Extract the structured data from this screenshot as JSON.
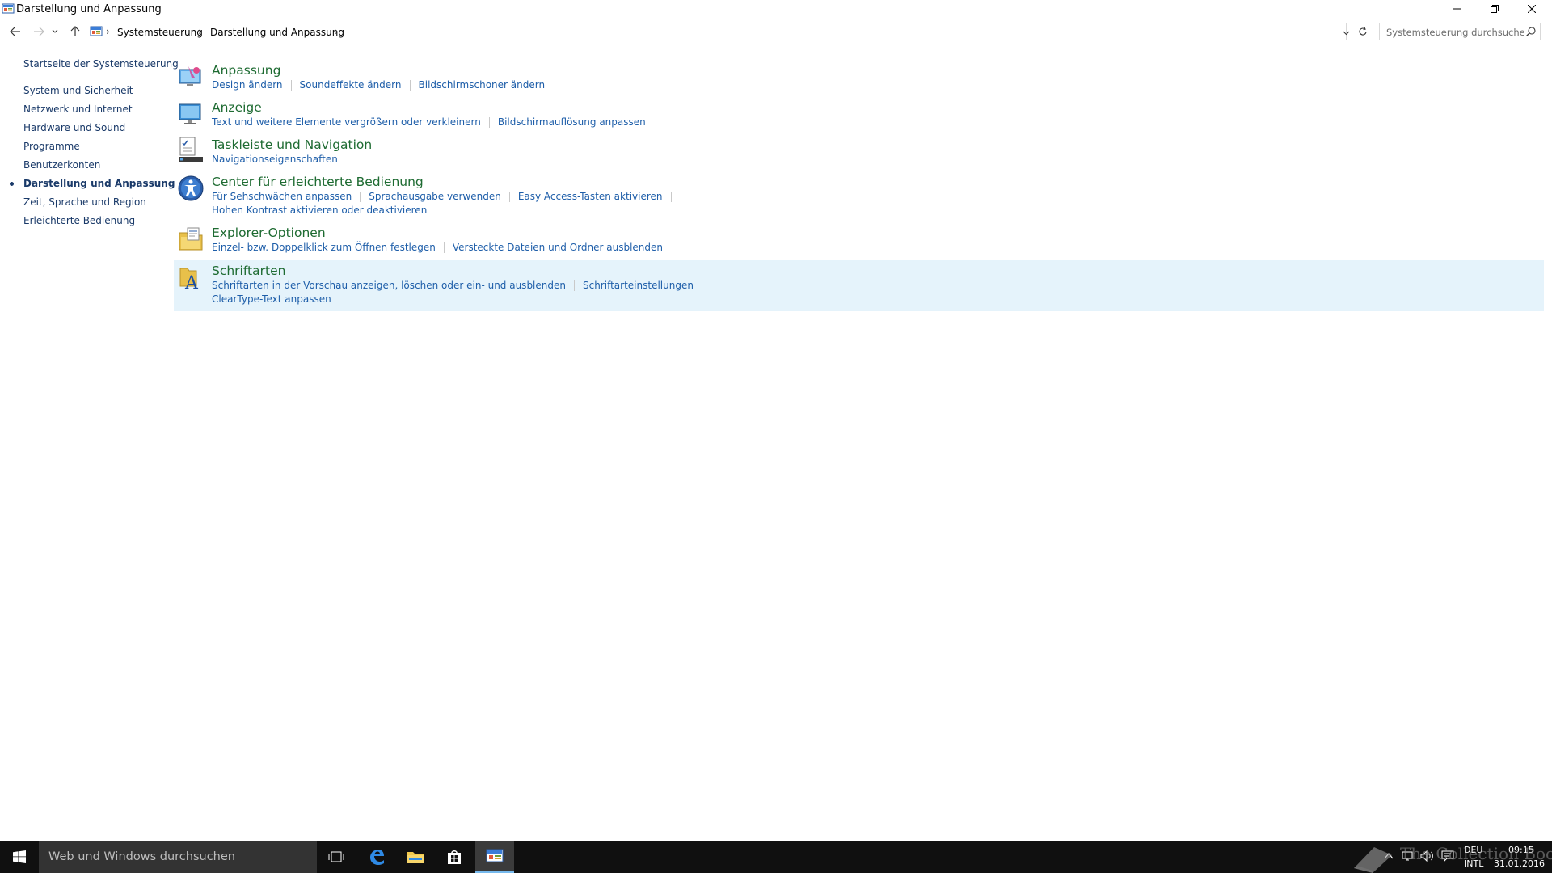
{
  "window": {
    "title": "Darstellung und Anpassung"
  },
  "address": {
    "crumbs": [
      "Systemsteuerung",
      "Darstellung und Anpassung"
    ],
    "search_placeholder": "Systemsteuerung durchsuchen"
  },
  "sidebar": {
    "home": "Startseite der Systemsteuerung",
    "items": [
      "System und Sicherheit",
      "Netzwerk und Internet",
      "Hardware und Sound",
      "Programme",
      "Benutzerkonten",
      "Darstellung und Anpassung",
      "Zeit, Sprache und Region",
      "Erleichterte Bedienung"
    ],
    "active_index": 5
  },
  "categories": [
    {
      "title": "Anpassung",
      "icon": "personalization-icon",
      "links": [
        [
          "Design ändern",
          "Soundeffekte ändern",
          "Bildschirmschoner ändern"
        ]
      ]
    },
    {
      "title": "Anzeige",
      "icon": "display-icon",
      "links": [
        [
          "Text und weitere Elemente vergrößern oder verkleinern",
          "Bildschirmauflösung anpassen"
        ]
      ]
    },
    {
      "title": "Taskleiste und Navigation",
      "icon": "taskbar-icon",
      "links": [
        [
          "Navigationseigenschaften"
        ]
      ]
    },
    {
      "title": "Center für erleichterte Bedienung",
      "icon": "ease-of-access-icon",
      "links": [
        [
          "Für Sehschwächen anpassen",
          "Sprachausgabe verwenden",
          "Easy Access-Tasten aktivieren"
        ],
        [
          "Hohen Kontrast aktivieren oder deaktivieren"
        ]
      ]
    },
    {
      "title": "Explorer-Optionen",
      "icon": "folder-options-icon",
      "links": [
        [
          "Einzel- bzw. Doppelklick zum Öffnen festlegen",
          "Versteckte Dateien und Ordner ausblenden"
        ]
      ]
    },
    {
      "title": "Schriftarten",
      "icon": "fonts-icon",
      "links": [
        [
          "Schriftarten in der Vorschau anzeigen, löschen oder ein- und ausblenden",
          "Schriftarteinstellungen"
        ],
        [
          "ClearType-Text anpassen"
        ]
      ]
    }
  ],
  "taskbar": {
    "search_text": "Web und Windows durchsuchen",
    "language_top": "DEU",
    "language_bottom": "INTL",
    "time": "09:15",
    "date": "31.01.2016",
    "watermark": "The Collection Book"
  }
}
